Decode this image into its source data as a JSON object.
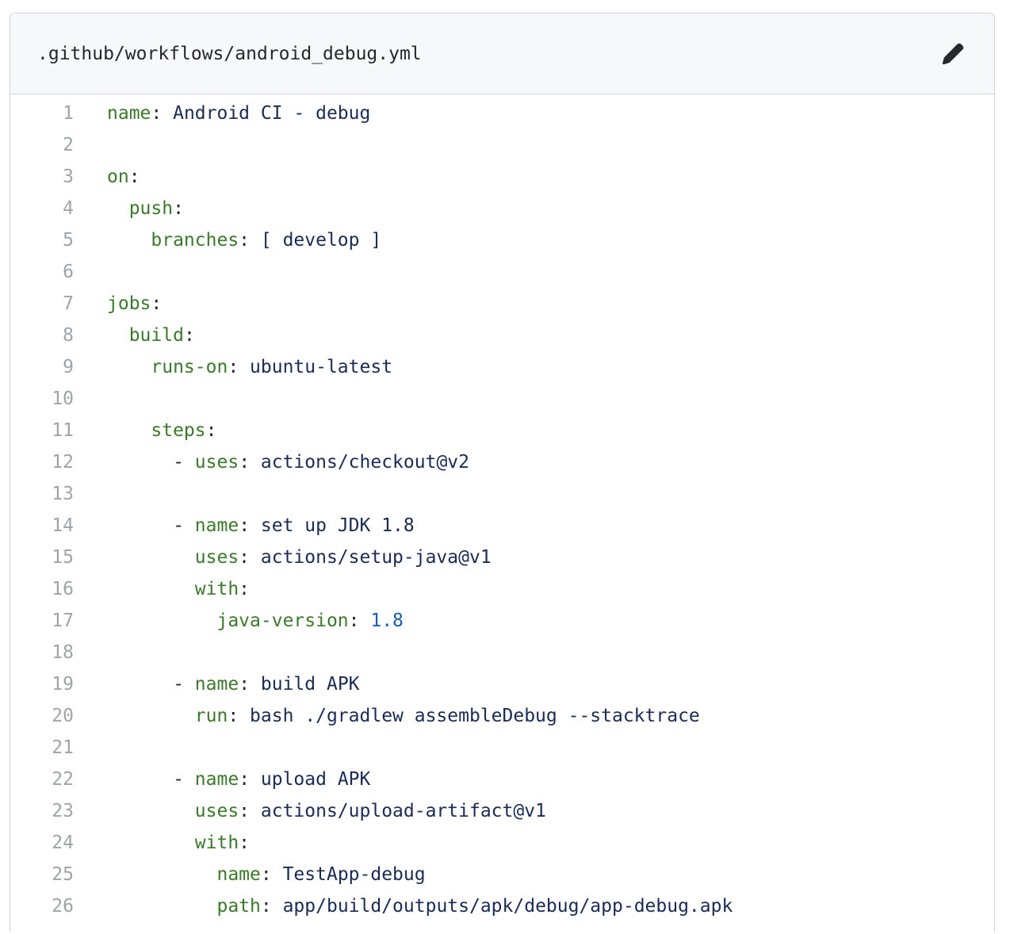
{
  "file": {
    "path": ".github/workflows/android_debug.yml",
    "edit_icon": "pencil-icon"
  },
  "colors": {
    "key": "#3a7a2a",
    "value": "#1b2b55",
    "number": "#1a5bb5",
    "line_number": "#a0a4a8",
    "header_bg": "#f6f8fa",
    "border": "#d1d5da"
  },
  "lines": [
    {
      "n": "1",
      "indent": "",
      "dash": "",
      "key": "name",
      "sep": ": ",
      "value": "Android CI - debug",
      "vtype": "str"
    },
    {
      "n": "2",
      "indent": "",
      "dash": "",
      "key": "",
      "sep": "",
      "value": "",
      "vtype": "str"
    },
    {
      "n": "3",
      "indent": "",
      "dash": "",
      "key": "on",
      "sep": ":",
      "value": "",
      "vtype": "str"
    },
    {
      "n": "4",
      "indent": "  ",
      "dash": "",
      "key": "push",
      "sep": ":",
      "value": "",
      "vtype": "str"
    },
    {
      "n": "5",
      "indent": "    ",
      "dash": "",
      "key": "branches",
      "sep": ": ",
      "value": "[ develop ]",
      "vtype": "str"
    },
    {
      "n": "6",
      "indent": "",
      "dash": "",
      "key": "",
      "sep": "",
      "value": "",
      "vtype": "str"
    },
    {
      "n": "7",
      "indent": "",
      "dash": "",
      "key": "jobs",
      "sep": ":",
      "value": "",
      "vtype": "str"
    },
    {
      "n": "8",
      "indent": "  ",
      "dash": "",
      "key": "build",
      "sep": ":",
      "value": "",
      "vtype": "str"
    },
    {
      "n": "9",
      "indent": "    ",
      "dash": "",
      "key": "runs-on",
      "sep": ": ",
      "value": "ubuntu-latest",
      "vtype": "str"
    },
    {
      "n": "10",
      "indent": "",
      "dash": "",
      "key": "",
      "sep": "",
      "value": "",
      "vtype": "str"
    },
    {
      "n": "11",
      "indent": "    ",
      "dash": "",
      "key": "steps",
      "sep": ":",
      "value": "",
      "vtype": "str"
    },
    {
      "n": "12",
      "indent": "      ",
      "dash": "- ",
      "key": "uses",
      "sep": ": ",
      "value": "actions/checkout@v2",
      "vtype": "str"
    },
    {
      "n": "13",
      "indent": "",
      "dash": "",
      "key": "",
      "sep": "",
      "value": "",
      "vtype": "str"
    },
    {
      "n": "14",
      "indent": "      ",
      "dash": "- ",
      "key": "name",
      "sep": ": ",
      "value": "set up JDK 1.8",
      "vtype": "str"
    },
    {
      "n": "15",
      "indent": "        ",
      "dash": "",
      "key": "uses",
      "sep": ": ",
      "value": "actions/setup-java@v1",
      "vtype": "str"
    },
    {
      "n": "16",
      "indent": "        ",
      "dash": "",
      "key": "with",
      "sep": ":",
      "value": "",
      "vtype": "str"
    },
    {
      "n": "17",
      "indent": "          ",
      "dash": "",
      "key": "java-version",
      "sep": ": ",
      "value": "1.8",
      "vtype": "num"
    },
    {
      "n": "18",
      "indent": "",
      "dash": "",
      "key": "",
      "sep": "",
      "value": "",
      "vtype": "str"
    },
    {
      "n": "19",
      "indent": "      ",
      "dash": "- ",
      "key": "name",
      "sep": ": ",
      "value": "build APK",
      "vtype": "str"
    },
    {
      "n": "20",
      "indent": "        ",
      "dash": "",
      "key": "run",
      "sep": ": ",
      "value": "bash ./gradlew assembleDebug --stacktrace",
      "vtype": "str"
    },
    {
      "n": "21",
      "indent": "",
      "dash": "",
      "key": "",
      "sep": "",
      "value": "",
      "vtype": "str"
    },
    {
      "n": "22",
      "indent": "      ",
      "dash": "- ",
      "key": "name",
      "sep": ": ",
      "value": "upload APK",
      "vtype": "str"
    },
    {
      "n": "23",
      "indent": "        ",
      "dash": "",
      "key": "uses",
      "sep": ": ",
      "value": "actions/upload-artifact@v1",
      "vtype": "str"
    },
    {
      "n": "24",
      "indent": "        ",
      "dash": "",
      "key": "with",
      "sep": ":",
      "value": "",
      "vtype": "str"
    },
    {
      "n": "25",
      "indent": "          ",
      "dash": "",
      "key": "name",
      "sep": ": ",
      "value": "TestApp-debug",
      "vtype": "str"
    },
    {
      "n": "26",
      "indent": "          ",
      "dash": "",
      "key": "path",
      "sep": ": ",
      "value": "app/build/outputs/apk/debug/app-debug.apk",
      "vtype": "str"
    }
  ]
}
